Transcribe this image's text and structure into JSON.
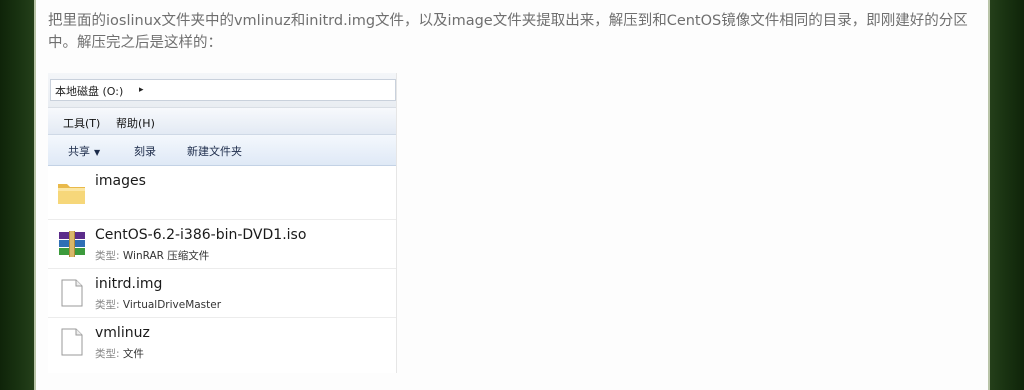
{
  "article": {
    "text": "把里面的ioslinux文件夹中的vmlinuz和initrd.img文件，以及image文件夹提取出来，解压到和CentOS镜像文件相同的目录，即刚建好的分区中。解压完之后是这样的："
  },
  "explorer": {
    "address_path": "本地磁盘 (O:)",
    "menu": {
      "tools_label": "工具(T)",
      "help_label": "帮助(H)"
    },
    "toolbar": {
      "share_label": "共享",
      "burn_label": "刻录",
      "new_folder_label": "新建文件夹"
    },
    "files": [
      {
        "name": "images",
        "type_key": "",
        "type_value": "",
        "icon": "folder-icon"
      },
      {
        "name": "CentOS-6.2-i386-bin-DVD1.iso",
        "type_key": "类型:",
        "type_value": "WinRAR 压缩文件",
        "icon": "winrar-archive-icon"
      },
      {
        "name": "initrd.img",
        "type_key": "类型:",
        "type_value": "VirtualDriveMaster",
        "icon": "file-icon"
      },
      {
        "name": "vmlinuz",
        "type_key": "类型:",
        "type_value": "文件",
        "icon": "file-icon"
      }
    ]
  },
  "colors": {
    "background": "#1f3a17",
    "page": "#fdfdfd",
    "article_text": "#6f6f6f",
    "toolbar_blue": "#dfe9f6"
  }
}
